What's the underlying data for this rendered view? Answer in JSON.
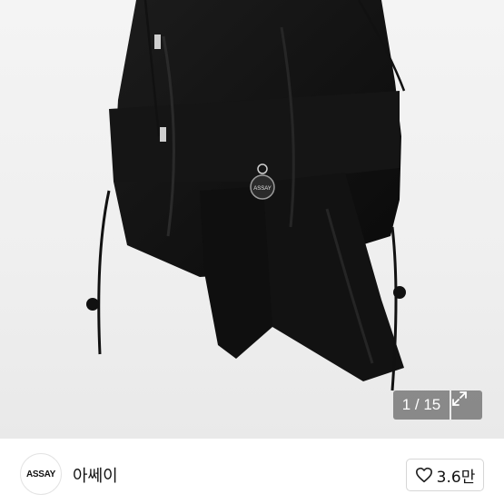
{
  "gallery": {
    "position_text": "1 / 15",
    "expand_icon": "expand-arrows-icon",
    "logo_tag_text": "ASSAY"
  },
  "shop": {
    "logo_text": "ASSAY",
    "name": "아쎄이",
    "like_icon": "heart-outline-icon",
    "like_count": "3.6만"
  }
}
